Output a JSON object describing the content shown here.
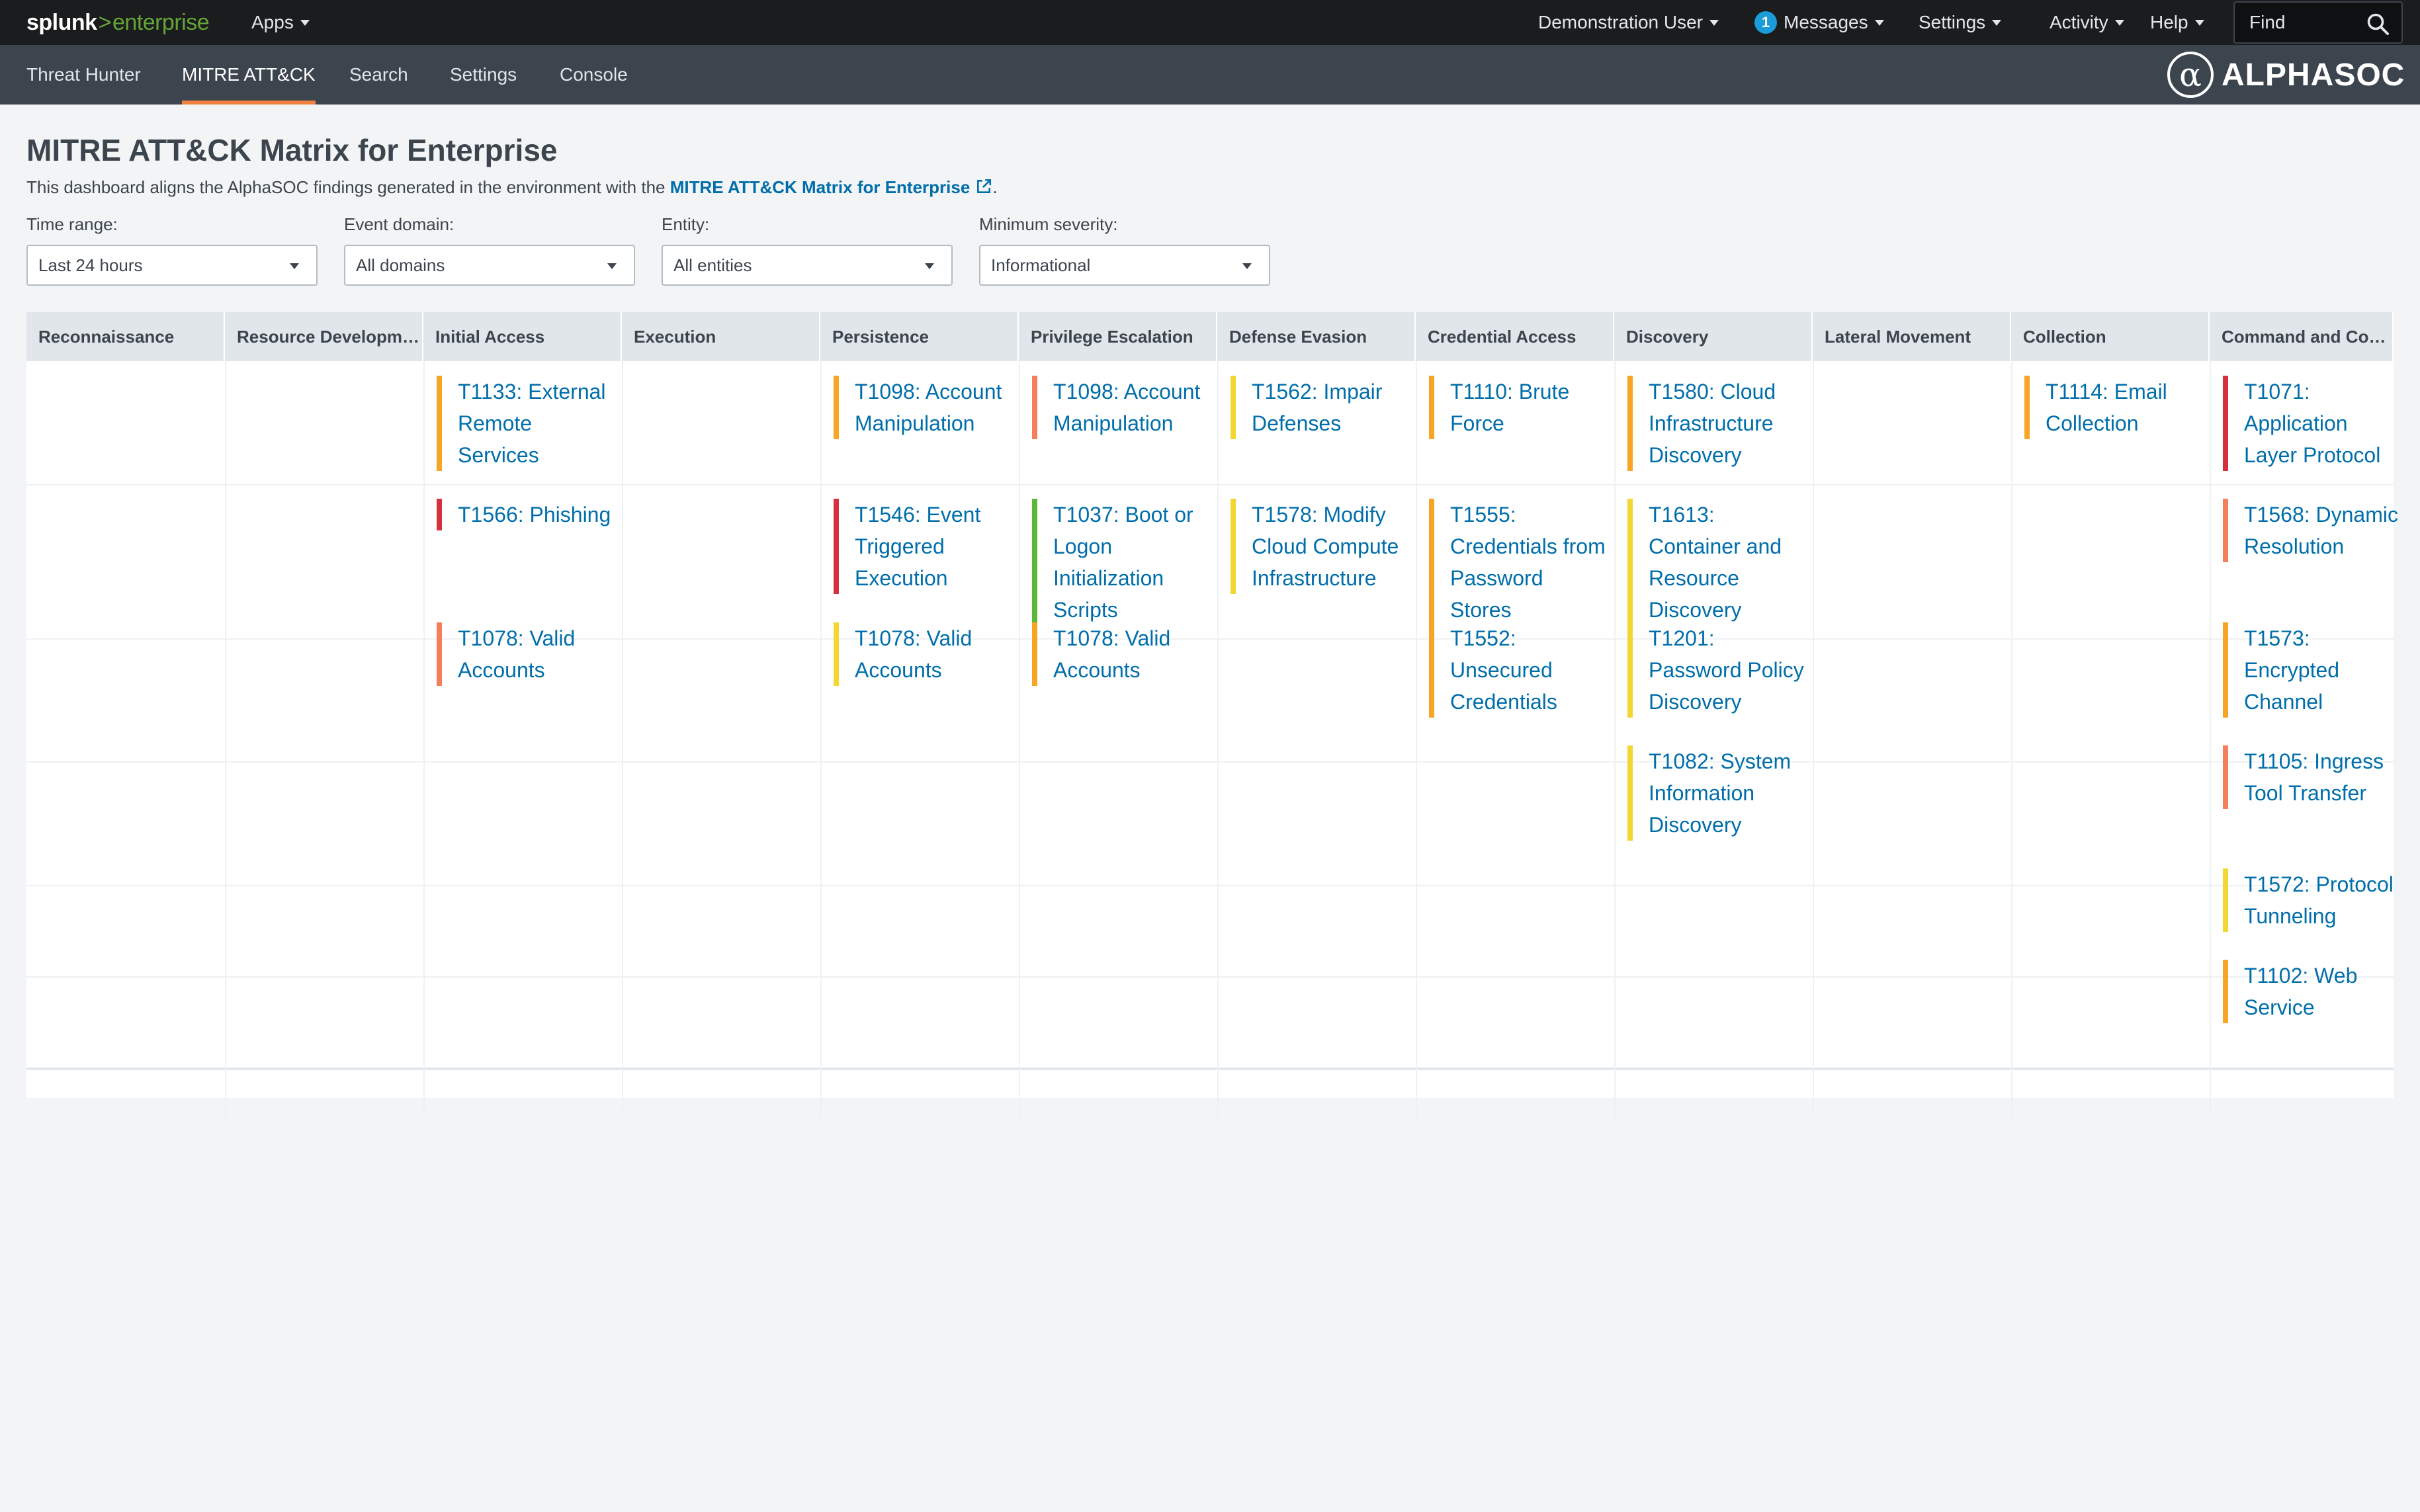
{
  "topbar": {
    "logo_brand": "splunk",
    "logo_gt": ">",
    "logo_product": "enterprise",
    "apps_label": "Apps",
    "user_label": "Demonstration User",
    "messages_count": "1",
    "messages_label": "Messages",
    "settings_label": "Settings",
    "activity_label": "Activity",
    "help_label": "Help",
    "find_placeholder": "Find"
  },
  "appnav": {
    "tabs": [
      "Threat Hunter",
      "MITRE ATT&CK",
      "Search",
      "Settings",
      "Console"
    ],
    "active_tab": "MITRE ATT&CK",
    "partner_logo": "ALPHASOC",
    "partner_glyph": "α"
  },
  "dashboard": {
    "title": "MITRE ATT&CK Matrix for Enterprise",
    "description_prefix": "This dashboard aligns the AlphaSOC findings generated in the environment with the ",
    "description_link": "MITRE ATT&CK Matrix for Enterprise",
    "description_suffix": "."
  },
  "inputs": {
    "time_range": {
      "label": "Time range:",
      "value": "Last 24 hours"
    },
    "event_domain": {
      "label": "Event domain:",
      "value": "All domains"
    },
    "entity": {
      "label": "Entity:",
      "value": "All entities"
    },
    "min_severity": {
      "label": "Minimum severity:",
      "value": "Informational"
    }
  },
  "colors": {
    "critical": "#d6303f",
    "high": "#f47f5a",
    "medium": "#f8a425",
    "low": "#f2d733",
    "informational": "#5cb837",
    "link": "#006eaa",
    "accent": "#f1813f"
  },
  "matrix": {
    "columns": [
      "Reconnaissance",
      "Resource Development",
      "Initial Access",
      "Execution",
      "Persistence",
      "Privilege Escalation",
      "Defense Evasion",
      "Credential Access",
      "Discovery",
      "Lateral Movement",
      "Collection",
      "Command and Control"
    ],
    "cells": [
      {
        "col": 2,
        "row": 0,
        "text": "T1133: External Remote Services",
        "severity": "medium"
      },
      {
        "col": 2,
        "row": 1,
        "text": "T1566: Phishing",
        "severity": "critical"
      },
      {
        "col": 2,
        "row": 2,
        "text": "T1078: Valid Accounts",
        "severity": "high"
      },
      {
        "col": 4,
        "row": 0,
        "text": "T1098: Account Manipulation",
        "severity": "medium"
      },
      {
        "col": 4,
        "row": 1,
        "text": "T1546: Event Triggered Execution",
        "severity": "critical"
      },
      {
        "col": 4,
        "row": 2,
        "text": "T1078: Valid Accounts",
        "severity": "low"
      },
      {
        "col": 5,
        "row": 0,
        "text": "T1098: Account Manipulation",
        "severity": "high"
      },
      {
        "col": 5,
        "row": 1,
        "text": "T1037: Boot or Logon Initialization Scripts",
        "severity": "informational"
      },
      {
        "col": 5,
        "row": 2,
        "text": "T1078: Valid Accounts",
        "severity": "medium"
      },
      {
        "col": 6,
        "row": 0,
        "text": "T1562: Impair Defenses",
        "severity": "low"
      },
      {
        "col": 6,
        "row": 1,
        "text": "T1578: Modify Cloud Compute Infrastructure",
        "severity": "low"
      },
      {
        "col": 7,
        "row": 0,
        "text": "T1110: Brute Force",
        "severity": "medium"
      },
      {
        "col": 7,
        "row": 1,
        "text": "T1555: Credentials from Password Stores",
        "severity": "medium"
      },
      {
        "col": 7,
        "row": 2,
        "text": "T1552: Unsecured Credentials",
        "severity": "medium"
      },
      {
        "col": 8,
        "row": 0,
        "text": "T1580: Cloud Infrastructure Discovery",
        "severity": "medium"
      },
      {
        "col": 8,
        "row": 1,
        "text": "T1613: Container and Resource Discovery",
        "severity": "low"
      },
      {
        "col": 8,
        "row": 2,
        "text": "T1201: Password Policy Discovery",
        "severity": "low"
      },
      {
        "col": 8,
        "row": 3,
        "text": "T1082: System Information Discovery",
        "severity": "low"
      },
      {
        "col": 10,
        "row": 0,
        "text": "T1114: Email Collection",
        "severity": "medium"
      },
      {
        "col": 11,
        "row": 0,
        "text": "T1071: Application Layer Protocol",
        "severity": "critical"
      },
      {
        "col": 11,
        "row": 1,
        "text": "T1568: Dynamic Resolution",
        "severity": "high"
      },
      {
        "col": 11,
        "row": 2,
        "text": "T1573: Encrypted Channel",
        "severity": "medium"
      },
      {
        "col": 11,
        "row": 3,
        "text": "T1105: Ingress Tool Transfer",
        "severity": "high"
      },
      {
        "col": 11,
        "row": 4,
        "text": "T1572: Protocol Tunneling",
        "severity": "low"
      },
      {
        "col": 11,
        "row": 5,
        "text": "T1102: Web Service",
        "severity": "medium"
      }
    ]
  }
}
